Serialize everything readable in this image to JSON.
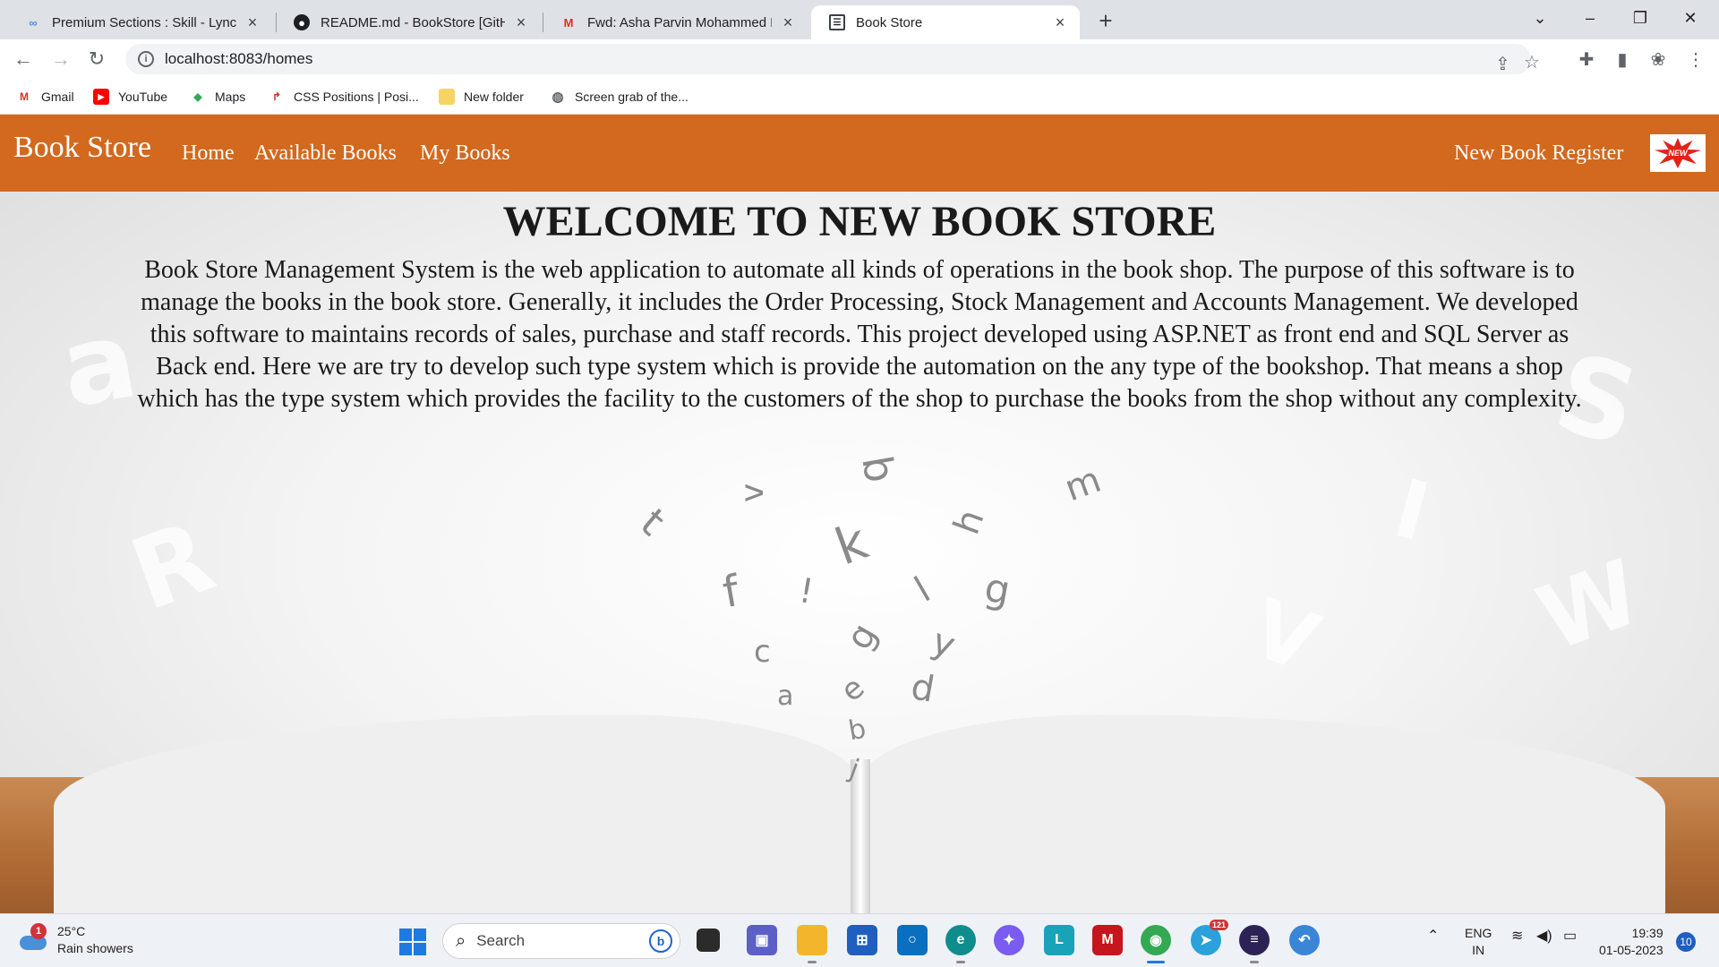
{
  "browser": {
    "tabs": [
      {
        "title": "Premium Sections : Skill - Lync",
        "icon": "lync-icon"
      },
      {
        "title": "README.md - BookStore [GitHub",
        "icon": "github-icon"
      },
      {
        "title": "Fwd: Asha Parvin Mohammed Ha",
        "icon": "gmail-icon"
      },
      {
        "title": "Book Store",
        "icon": "page-icon",
        "active": true
      }
    ],
    "url": "localhost:8083/homes",
    "bookmarks": [
      {
        "label": "Gmail",
        "icon": "gmail-icon"
      },
      {
        "label": "YouTube",
        "icon": "youtube-icon"
      },
      {
        "label": "Maps",
        "icon": "maps-icon"
      },
      {
        "label": "CSS Positions | Posi...",
        "icon": "css-icon"
      },
      {
        "label": "New folder",
        "icon": "folder-icon"
      },
      {
        "label": "Screen grab of the...",
        "icon": "globe-icon"
      }
    ]
  },
  "site": {
    "brand": "Book Store",
    "nav": [
      "Home",
      "Available Books",
      "My Books"
    ],
    "register": "New Book Register",
    "badge_text": "NEW",
    "heading": "WELCOME TO NEW BOOK STORE",
    "about": "Book Store Management System is the web application to automate all kinds of operations in the book shop. The purpose of this software is to manage the books in the book store. Generally, it includes the Order Processing, Stock Management and Accounts Management. We developed this software to maintains records of sales, purchase and staff records. This project developed using ASP.NET as front end and SQL Server as Back end. Here we are try to develop such type system which is provide the automation on the any type of the bookshop. That means a shop which has the type system which provides the facility to the customers of the shop to purchase the books from the shop without any complexity."
  },
  "taskbar": {
    "weather_alert_count": "1",
    "temperature": "25°C",
    "weather": "Rain showers",
    "search_label": "Search",
    "telegram_badge": "121",
    "language": "ENG",
    "region": "IN",
    "time": "19:39",
    "date": "01-05-2023",
    "notification_count": "10"
  },
  "colors": {
    "nav_bg": "#d2691e",
    "accent_blue": "#1f7ae0"
  }
}
